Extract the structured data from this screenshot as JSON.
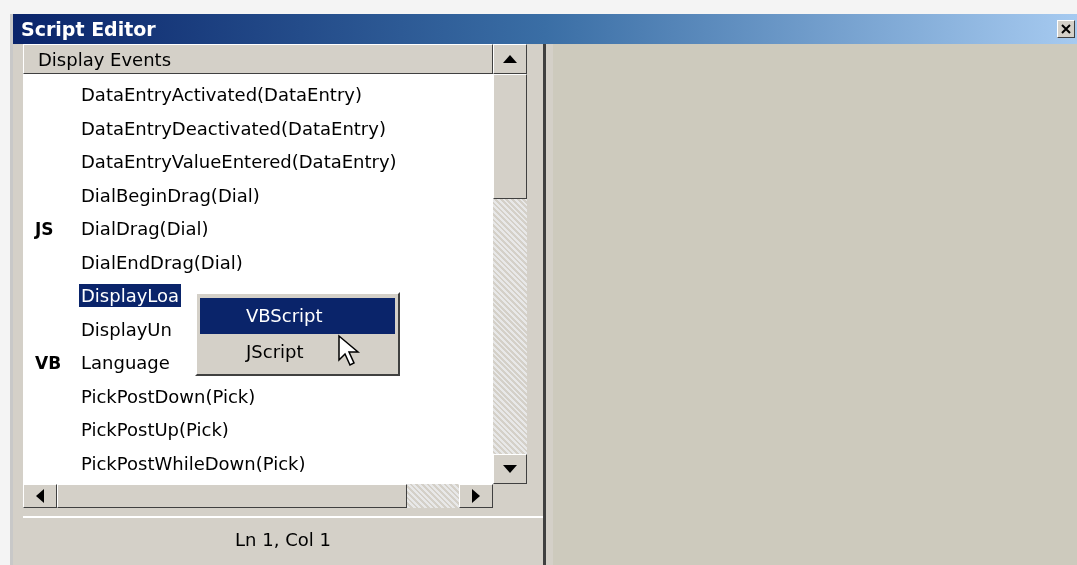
{
  "window": {
    "title": "Script Editor"
  },
  "event_list": {
    "header": "Display Events",
    "items": [
      {
        "label": "DataEntryActivated(DataEntry)",
        "marker": "",
        "selected": false
      },
      {
        "label": "DataEntryDeactivated(DataEntry)",
        "marker": "",
        "selected": false
      },
      {
        "label": "DataEntryValueEntered(DataEntry)",
        "marker": "",
        "selected": false
      },
      {
        "label": "DialBeginDrag(Dial)",
        "marker": "",
        "selected": false
      },
      {
        "label": "DialDrag(Dial)",
        "marker": "JS",
        "selected": false
      },
      {
        "label": "DialEndDrag(Dial)",
        "marker": "",
        "selected": false
      },
      {
        "label": "DisplayLoa",
        "marker": "",
        "selected": true
      },
      {
        "label": "DisplayUn",
        "marker": "",
        "selected": false
      },
      {
        "label": "Language",
        "marker": "VB",
        "selected": false
      },
      {
        "label": "PickPostDown(Pick)",
        "marker": "",
        "selected": false
      },
      {
        "label": "PickPostUp(Pick)",
        "marker": "",
        "selected": false
      },
      {
        "label": "PickPostWhileDown(Pick)",
        "marker": "",
        "selected": false
      }
    ]
  },
  "context_menu": {
    "items": [
      {
        "label": "VBScript",
        "selected": true
      },
      {
        "label": "JScript",
        "selected": false
      }
    ]
  },
  "status_bar": {
    "position": "Ln 1, Col 1"
  }
}
